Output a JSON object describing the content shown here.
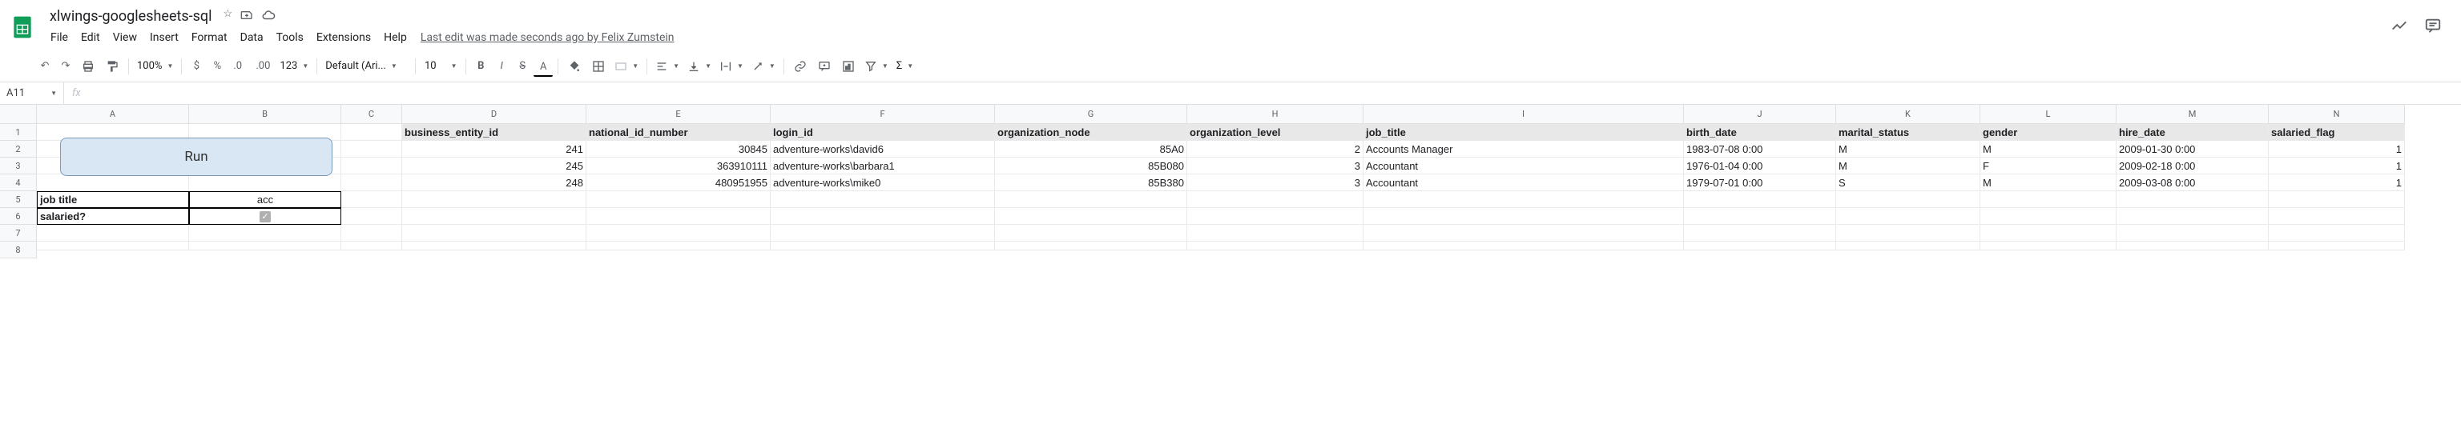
{
  "doc_title": "xlwings-googlesheets-sql",
  "menus": [
    "File",
    "Edit",
    "View",
    "Insert",
    "Format",
    "Data",
    "Tools",
    "Extensions",
    "Help"
  ],
  "last_edit": "Last edit was made seconds ago by Felix Zumstein",
  "zoom": "100%",
  "font_name": "Default (Ari...",
  "font_size": "10",
  "namebox": "A11",
  "run_button": "Run",
  "columns": [
    "A",
    "B",
    "C",
    "D",
    "E",
    "F",
    "G",
    "H",
    "I",
    "J",
    "K",
    "L",
    "M",
    "N"
  ],
  "row_numbers": [
    "1",
    "2",
    "3",
    "4",
    "5",
    "6",
    "7",
    "8"
  ],
  "headers": {
    "D": "business_entity_id",
    "E": "national_id_number",
    "F": "login_id",
    "G": "organization_node",
    "H": "organization_level",
    "I": "job_title",
    "J": "birth_date",
    "K": "marital_status",
    "L": "gender",
    "M": "hire_date",
    "N": "salaried_flag"
  },
  "rows": [
    {
      "D": "241",
      "E": "30845",
      "F": "adventure-works\\david6",
      "G": "85A0",
      "H": "2",
      "I": "Accounts Manager",
      "J": "1983-07-08 0:00",
      "K": "M",
      "L": "M",
      "M": "2009-01-30 0:00",
      "N": "1"
    },
    {
      "D": "245",
      "E": "363910111",
      "F": "adventure-works\\barbara1",
      "G": "85B080",
      "H": "3",
      "I": "Accountant",
      "J": "1976-01-04 0:00",
      "K": "M",
      "L": "F",
      "M": "2009-02-18 0:00",
      "N": "1"
    },
    {
      "D": "248",
      "E": "480951955",
      "F": "adventure-works\\mike0",
      "G": "85B380",
      "H": "3",
      "I": "Accountant",
      "J": "1979-07-01 0:00",
      "K": "S",
      "L": "M",
      "M": "2009-03-08 0:00",
      "N": "1"
    }
  ],
  "inputs": {
    "job_title_label": "job title",
    "job_title_value": "acc",
    "salaried_label": "salaried?"
  }
}
